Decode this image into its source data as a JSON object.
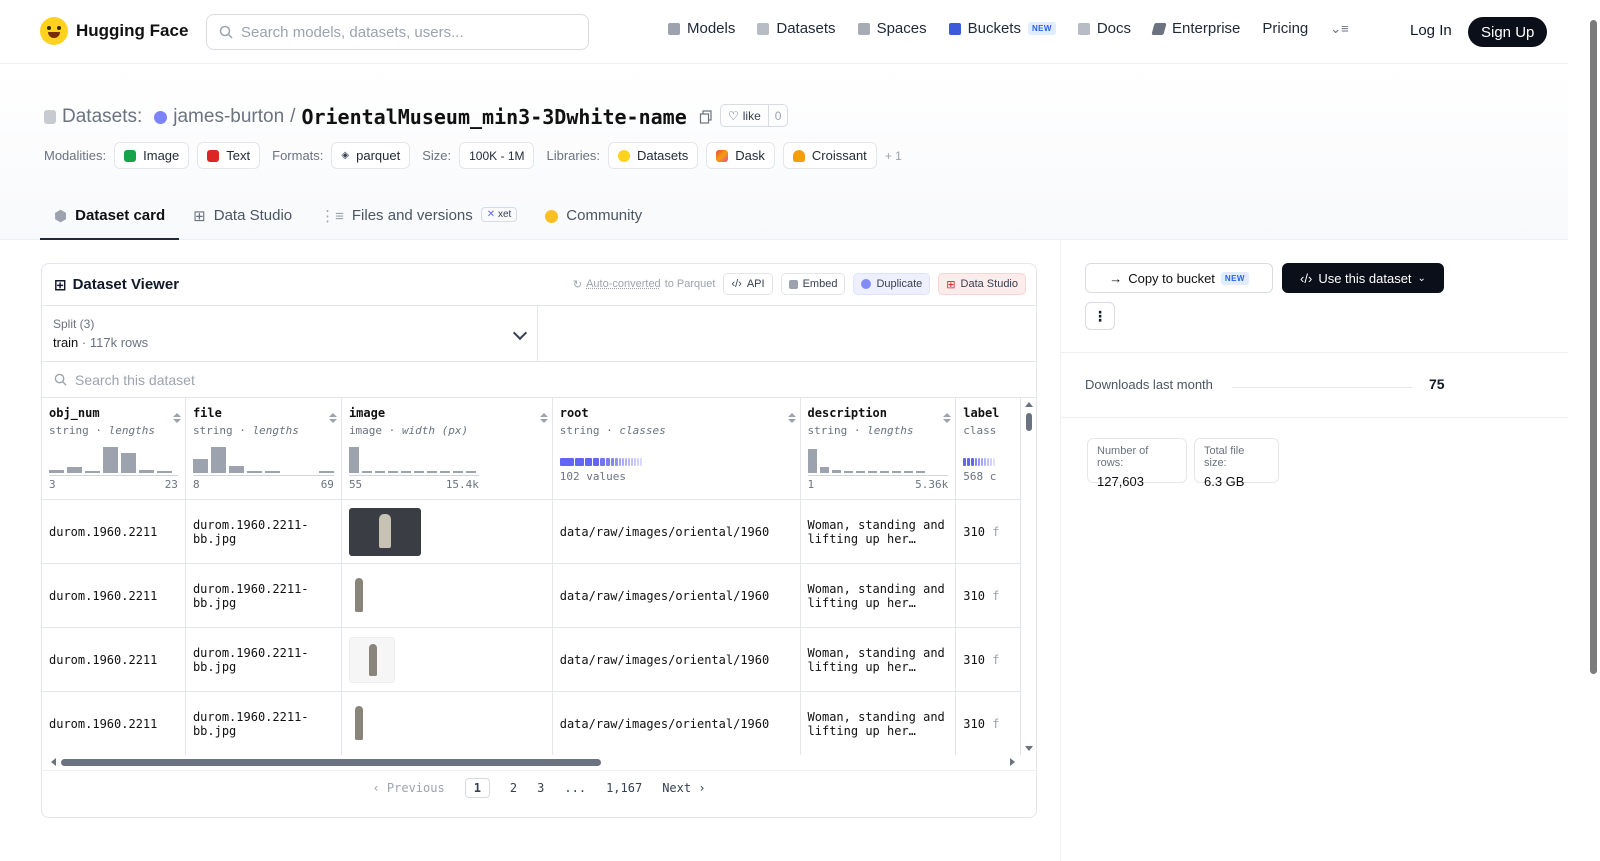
{
  "nav": {
    "brand": "Hugging Face",
    "search_placeholder": "Search models, datasets, users...",
    "links": [
      "Models",
      "Datasets",
      "Spaces",
      "Buckets",
      "Docs",
      "Enterprise",
      "Pricing"
    ],
    "new_badge": "NEW",
    "login": "Log In",
    "signup": "Sign Up"
  },
  "header": {
    "prefix": "Datasets:",
    "owner": "james-burton",
    "sep": "/",
    "repo": "OrientalMuseum_min3-3Dwhite-name",
    "like": "like",
    "like_count": "0",
    "modalities_label": "Modalities:",
    "modalities": [
      "Image",
      "Text"
    ],
    "formats_label": "Formats:",
    "format": "parquet",
    "size_label": "Size:",
    "size": "100K - 1M",
    "libraries_label": "Libraries:",
    "libraries": [
      "Datasets",
      "Dask",
      "Croissant"
    ],
    "libraries_more": "+ 1"
  },
  "tabs": [
    "Dataset card",
    "Data Studio",
    "Files and versions",
    "Community"
  ],
  "xet_badge": "xet",
  "viewer": {
    "title": "Dataset Viewer",
    "auto_converted": "Auto-converted",
    "to_parquet": "to Parquet",
    "api": "API",
    "embed": "Embed",
    "duplicate": "Duplicate",
    "data_studio": "Data Studio",
    "split_label": "Split (3)",
    "split_value": "train",
    "split_rows": "117k rows",
    "search_placeholder": "Search this dataset",
    "columns": [
      {
        "name": "obj_num",
        "type": "string",
        "stat": "lengths",
        "min": "3",
        "max": "23"
      },
      {
        "name": "file",
        "type": "string",
        "stat": "lengths",
        "min": "8",
        "max": "69"
      },
      {
        "name": "image",
        "type": "image",
        "stat": "width (px)",
        "min": "55",
        "max": "15.4k"
      },
      {
        "name": "root",
        "type": "string",
        "stat": "classes",
        "min": "102 values",
        "max": ""
      },
      {
        "name": "description",
        "type": "string",
        "stat": "lengths",
        "min": "1",
        "max": "5.36k"
      },
      {
        "name": "label",
        "type": "class",
        "stat": "",
        "min": "568 c",
        "max": ""
      }
    ],
    "rows": [
      {
        "obj_num": "durom.1960.2211",
        "file": "durom.1960.2211-bb.jpg",
        "root": "data/raw/images/oriental/1960",
        "description": "Woman, standing and lifting up her…",
        "label": "310",
        "label_tail": "f"
      },
      {
        "obj_num": "durom.1960.2211",
        "file": "durom.1960.2211-bb.jpg",
        "root": "data/raw/images/oriental/1960",
        "description": "Woman, standing and lifting up her…",
        "label": "310",
        "label_tail": "f"
      },
      {
        "obj_num": "durom.1960.2211",
        "file": "durom.1960.2211-bb.jpg",
        "root": "data/raw/images/oriental/1960",
        "description": "Woman, standing and lifting up her…",
        "label": "310",
        "label_tail": "f"
      },
      {
        "obj_num": "durom.1960.2211",
        "file": "durom.1960.2211-bb.jpg",
        "root": "data/raw/images/oriental/1960",
        "description": "Woman, standing and lifting up her…",
        "label": "310",
        "label_tail": "f"
      }
    ],
    "pager": {
      "prev": "Previous",
      "pages": [
        "1",
        "2",
        "3",
        "...",
        "1,167"
      ],
      "next": "Next"
    }
  },
  "sidebar": {
    "copy_to_bucket": "Copy to bucket",
    "new_badge": "NEW",
    "use_dataset": "Use this dataset",
    "downloads_label": "Downloads last month",
    "downloads_value": "75",
    "rows_label": "Number of rows:",
    "rows_value": "127,603",
    "size_label": "Total file size:",
    "size_value": "6.3 GB"
  }
}
